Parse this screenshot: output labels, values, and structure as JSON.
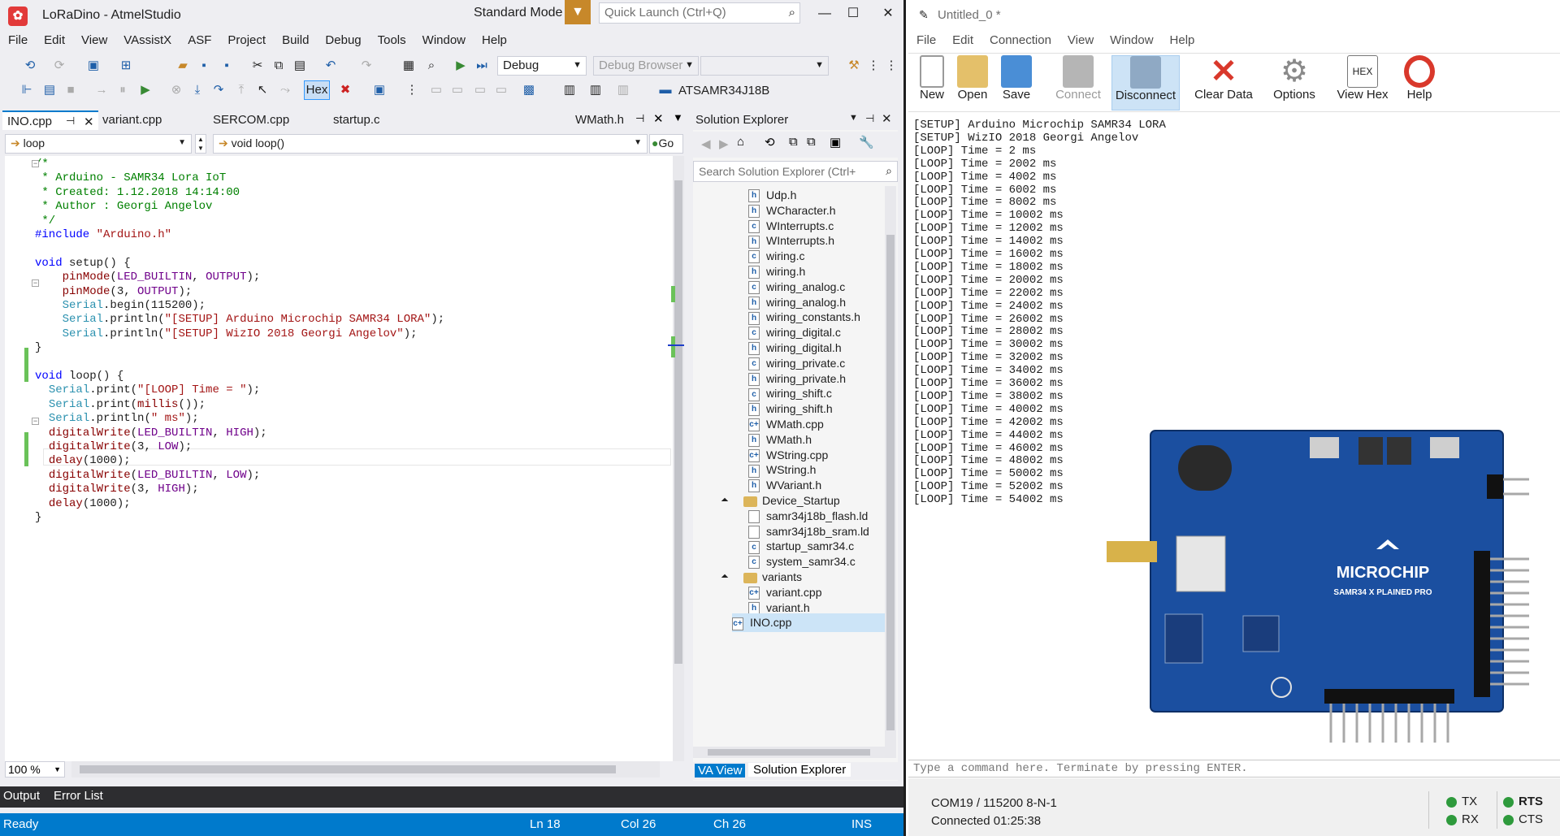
{
  "atmel": {
    "title": "LoRaDino - AtmelStudio",
    "mode": "Standard Mode",
    "quick_launch_placeholder": "Quick Launch (Ctrl+Q)",
    "menu": [
      "File",
      "Edit",
      "View",
      "VAssistX",
      "ASF",
      "Project",
      "Build",
      "Debug",
      "Tools",
      "Window",
      "Help"
    ],
    "config": "Debug",
    "debug_browser": "Debug Browser",
    "hex_label": "Hex",
    "device": "ATSAMR34J18B",
    "tabs": [
      "INO.cpp",
      "variant.cpp",
      "SERCOM.cpp",
      "startup.c",
      "WMath.h"
    ],
    "scope_combo": "loop",
    "member_combo": "void loop()",
    "go_label": "Go",
    "code": [
      [
        [
          "cm",
          "/*"
        ]
      ],
      [
        [
          "cm",
          " * Arduino - SAMR34 Lora IoT"
        ]
      ],
      [
        [
          "cm",
          " * Created: 1.12.2018 14:14:00"
        ]
      ],
      [
        [
          "cm",
          " * Author : Georgi Angelov"
        ]
      ],
      [
        [
          "cm",
          " */"
        ]
      ],
      [
        [
          "kw",
          "#include "
        ],
        [
          "st",
          "\"Arduino.h\""
        ]
      ],
      [],
      [
        [
          "kw",
          "void "
        ],
        [
          "df",
          "setup() {"
        ]
      ],
      [
        [
          "df",
          "    "
        ],
        [
          "fn",
          "pinMode"
        ],
        [
          "df",
          "("
        ],
        [
          "id",
          "LED_BUILTIN"
        ],
        [
          "df",
          ", "
        ],
        [
          "id",
          "OUTPUT"
        ],
        [
          "df",
          ");"
        ]
      ],
      [
        [
          "df",
          "    "
        ],
        [
          "fn",
          "pinMode"
        ],
        [
          "df",
          "(3, "
        ],
        [
          "id",
          "OUTPUT"
        ],
        [
          "df",
          ");"
        ]
      ],
      [
        [
          "df",
          "    "
        ],
        [
          "ty",
          "Serial"
        ],
        [
          "df",
          ".begin(115200);"
        ]
      ],
      [
        [
          "df",
          "    "
        ],
        [
          "ty",
          "Serial"
        ],
        [
          "df",
          ".println("
        ],
        [
          "st",
          "\"[SETUP] Arduino Microchip SAMR34 LORA\""
        ],
        [
          "df",
          ");"
        ]
      ],
      [
        [
          "df",
          "    "
        ],
        [
          "ty",
          "Serial"
        ],
        [
          "df",
          ".println("
        ],
        [
          "st",
          "\"[SETUP] WizIO 2018 Georgi Angelov\""
        ],
        [
          "df",
          ");"
        ]
      ],
      [
        [
          "df",
          "}"
        ]
      ],
      [],
      [
        [
          "kw",
          "void "
        ],
        [
          "df",
          "loop() {"
        ]
      ],
      [
        [
          "df",
          "  "
        ],
        [
          "ty",
          "Serial"
        ],
        [
          "df",
          ".print("
        ],
        [
          "st",
          "\"[LOOP] Time = \""
        ],
        [
          "df",
          ");"
        ]
      ],
      [
        [
          "df",
          "  "
        ],
        [
          "ty",
          "Serial"
        ],
        [
          "df",
          ".print("
        ],
        [
          "fn",
          "millis"
        ],
        [
          "df",
          "());"
        ]
      ],
      [
        [
          "df",
          "  "
        ],
        [
          "ty",
          "Serial"
        ],
        [
          "df",
          ".println("
        ],
        [
          "st",
          "\" ms\""
        ],
        [
          "df",
          ");"
        ]
      ],
      [
        [
          "df",
          "  "
        ],
        [
          "fn",
          "digitalWrite"
        ],
        [
          "df",
          "("
        ],
        [
          "id",
          "LED_BUILTIN"
        ],
        [
          "df",
          ", "
        ],
        [
          "id",
          "HIGH"
        ],
        [
          "df",
          ");"
        ]
      ],
      [
        [
          "df",
          "  "
        ],
        [
          "fn",
          "digitalWrite"
        ],
        [
          "df",
          "(3, "
        ],
        [
          "id",
          "LOW"
        ],
        [
          "df",
          ");"
        ]
      ],
      [
        [
          "df",
          "  "
        ],
        [
          "fn",
          "delay"
        ],
        [
          "df",
          "(1000);"
        ]
      ],
      [
        [
          "df",
          "  "
        ],
        [
          "fn",
          "digitalWrite"
        ],
        [
          "df",
          "("
        ],
        [
          "id",
          "LED_BUILTIN"
        ],
        [
          "df",
          ", "
        ],
        [
          "id",
          "LOW"
        ],
        [
          "df",
          ");"
        ]
      ],
      [
        [
          "df",
          "  "
        ],
        [
          "fn",
          "digitalWrite"
        ],
        [
          "df",
          "(3, "
        ],
        [
          "id",
          "HIGH"
        ],
        [
          "df",
          ");"
        ]
      ],
      [
        [
          "df",
          "  "
        ],
        [
          "fn",
          "delay"
        ],
        [
          "df",
          "(1000);"
        ]
      ],
      [
        [
          "df",
          "}"
        ]
      ]
    ],
    "zoom": "100 %",
    "solution_explorer": {
      "title": "Solution Explorer",
      "search_placeholder": "Search Solution Explorer (Ctrl+",
      "items": [
        {
          "icon": "h",
          "label": "Udp.h",
          "level": 1
        },
        {
          "icon": "h",
          "label": "WCharacter.h",
          "level": 1
        },
        {
          "icon": "c",
          "label": "WInterrupts.c",
          "level": 1
        },
        {
          "icon": "h",
          "label": "WInterrupts.h",
          "level": 1
        },
        {
          "icon": "c",
          "label": "wiring.c",
          "level": 1
        },
        {
          "icon": "h",
          "label": "wiring.h",
          "level": 1
        },
        {
          "icon": "c",
          "label": "wiring_analog.c",
          "level": 1
        },
        {
          "icon": "h",
          "label": "wiring_analog.h",
          "level": 1
        },
        {
          "icon": "h",
          "label": "wiring_constants.h",
          "level": 1
        },
        {
          "icon": "c",
          "label": "wiring_digital.c",
          "level": 1
        },
        {
          "icon": "h",
          "label": "wiring_digital.h",
          "level": 1
        },
        {
          "icon": "c",
          "label": "wiring_private.c",
          "level": 1
        },
        {
          "icon": "h",
          "label": "wiring_private.h",
          "level": 1
        },
        {
          "icon": "c",
          "label": "wiring_shift.c",
          "level": 1
        },
        {
          "icon": "h",
          "label": "wiring_shift.h",
          "level": 1
        },
        {
          "icon": "cpp",
          "label": "WMath.cpp",
          "level": 1
        },
        {
          "icon": "h",
          "label": "WMath.h",
          "level": 1
        },
        {
          "icon": "cpp",
          "label": "WString.cpp",
          "level": 1
        },
        {
          "icon": "h",
          "label": "WString.h",
          "level": 1
        },
        {
          "icon": "h",
          "label": "WVariant.h",
          "level": 1
        },
        {
          "icon": "folder",
          "label": "Device_Startup",
          "level": 0
        },
        {
          "icon": "file",
          "label": "samr34j18b_flash.ld",
          "level": 1
        },
        {
          "icon": "file",
          "label": "samr34j18b_sram.ld",
          "level": 1
        },
        {
          "icon": "c",
          "label": "startup_samr34.c",
          "level": 1
        },
        {
          "icon": "c",
          "label": "system_samr34.c",
          "level": 1
        },
        {
          "icon": "folder",
          "label": "variants",
          "level": 0
        },
        {
          "icon": "cpp",
          "label": "variant.cpp",
          "level": 1
        },
        {
          "icon": "h",
          "label": "variant.h",
          "level": 1
        },
        {
          "icon": "cpp",
          "label": "INO.cpp",
          "level": -1
        }
      ]
    },
    "bottom_tabs": [
      "VA View",
      "Solution Explorer"
    ],
    "output_tabs": [
      "Output",
      "Error List"
    ],
    "status": {
      "ready": "Ready",
      "ln": "Ln 18",
      "col": "Col 26",
      "ch": "Ch 26",
      "ins": "INS"
    }
  },
  "terminal": {
    "title": "Untitled_0 *",
    "menu": [
      "File",
      "Edit",
      "Connection",
      "View",
      "Window",
      "Help"
    ],
    "buttons": [
      "New",
      "Open",
      "Save",
      "Connect",
      "Disconnect",
      "Clear Data",
      "Options",
      "View Hex",
      "Help"
    ],
    "hex_icon_text": "HEX",
    "lines": [
      "[SETUP] Arduino Microchip SAMR34 LORA",
      "[SETUP] WizIO 2018 Georgi Angelov",
      "[LOOP] Time = 2 ms",
      "[LOOP] Time = 2002 ms",
      "[LOOP] Time = 4002 ms",
      "[LOOP] Time = 6002 ms",
      "[LOOP] Time = 8002 ms",
      "[LOOP] Time = 10002 ms",
      "[LOOP] Time = 12002 ms",
      "[LOOP] Time = 14002 ms",
      "[LOOP] Time = 16002 ms",
      "[LOOP] Time = 18002 ms",
      "[LOOP] Time = 20002 ms",
      "[LOOP] Time = 22002 ms",
      "[LOOP] Time = 24002 ms",
      "[LOOP] Time = 26002 ms",
      "[LOOP] Time = 28002 ms",
      "[LOOP] Time = 30002 ms",
      "[LOOP] Time = 32002 ms",
      "[LOOP] Time = 34002 ms",
      "[LOOP] Time = 36002 ms",
      "[LOOP] Time = 38002 ms",
      "[LOOP] Time = 40002 ms",
      "[LOOP] Time = 42002 ms",
      "[LOOP] Time = 44002 ms",
      "[LOOP] Time = 46002 ms",
      "[LOOP] Time = 48002 ms",
      "[LOOP] Time = 50002 ms",
      "[LOOP] Time = 52002 ms",
      "[LOOP] Time = 54002 ms"
    ],
    "command_placeholder": "Type a command here. Terminate by pressing ENTER.",
    "port": "COM19 / 115200 8-N-1",
    "connected": "Connected 01:25:38",
    "leds": [
      "TX",
      "RX",
      "RTS",
      "CTS"
    ],
    "board_logo": "MICROCHIP",
    "board_name": "SAMR34 X PLAINED PRO"
  },
  "colors": {
    "accent": "#007acc",
    "status": "#007acc",
    "led": "#2e9a3c",
    "board": "#1b4fa0"
  }
}
